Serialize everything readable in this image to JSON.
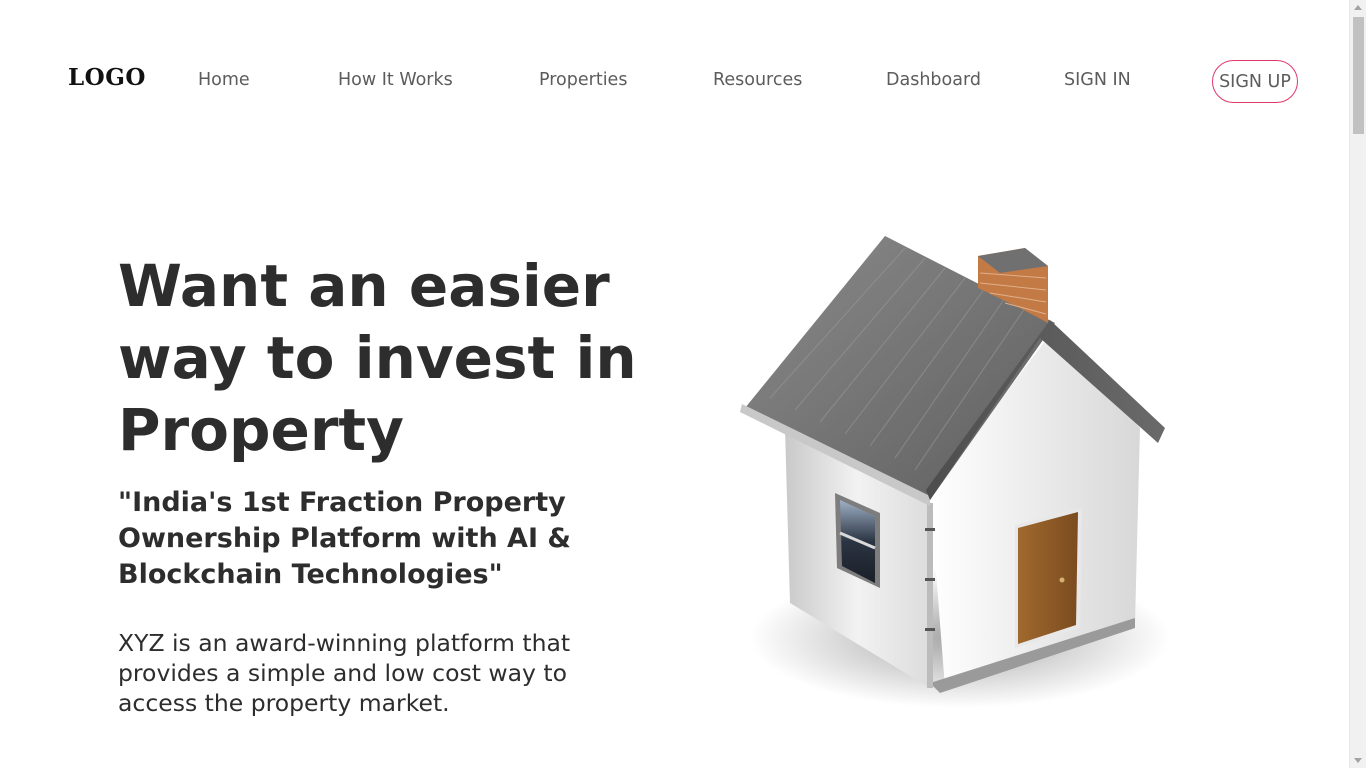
{
  "nav": {
    "logo": "LOGO",
    "links": [
      "Home",
      "How It Works",
      "Properties",
      "Resources",
      "Dashboard",
      "SIGN IN"
    ],
    "signup": "SIGN UP"
  },
  "hero": {
    "title": "Want an easier way to invest in Property",
    "subtitle": "\"India's 1st Fraction Property Ownership Platform with AI & Blockchain Technologies\"",
    "description": "XYZ is an award-winning platform that provides a simple and low cost way to access the property market."
  },
  "image": {
    "icon": "house-icon"
  },
  "colors": {
    "accent": "#e0386a",
    "text": "#2d2d2d",
    "nav_text": "#5c5c5c"
  }
}
